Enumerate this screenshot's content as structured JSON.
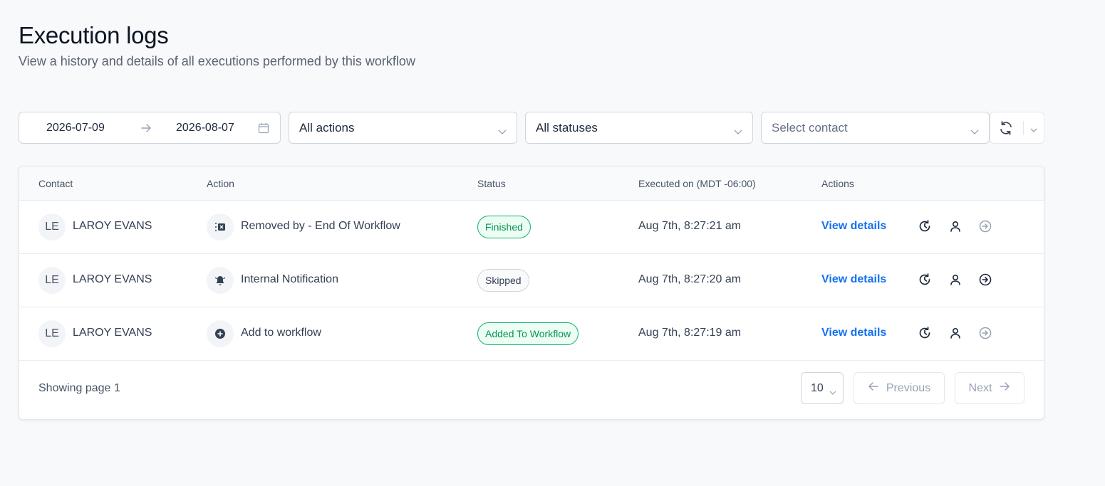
{
  "header": {
    "title": "Execution logs",
    "subtitle": "View a history and details of all executions performed by this workflow"
  },
  "filters": {
    "date_start": "2026-07-09",
    "date_end": "2026-08-07",
    "actions": "All actions",
    "statuses": "All statuses",
    "contact_placeholder": "Select contact"
  },
  "table": {
    "columns": {
      "contact": "Contact",
      "action": "Action",
      "status": "Status",
      "executed_on": "Executed on (MDT -06:00)",
      "actions": "Actions"
    },
    "rows": [
      {
        "initials": "LE",
        "contact": "LAROY EVANS",
        "action": "Removed by - End Of Workflow",
        "action_icon": "remove-from-workflow-icon",
        "status": "Finished",
        "status_style": "green",
        "executed": "Aug 7th, 8:27:21 am",
        "link": "View details",
        "exit_enabled": false
      },
      {
        "initials": "LE",
        "contact": "LAROY EVANS",
        "action": "Internal Notification",
        "action_icon": "bell-icon",
        "status": "Skipped",
        "status_style": "gray",
        "executed": "Aug 7th, 8:27:20 am",
        "link": "View details",
        "exit_enabled": true
      },
      {
        "initials": "LE",
        "contact": "LAROY EVANS",
        "action": "Add to workflow",
        "action_icon": "plus-circle-icon",
        "status": "Added To Workflow",
        "status_style": "green",
        "executed": "Aug 7th, 8:27:19 am",
        "link": "View details",
        "exit_enabled": false
      }
    ]
  },
  "footer": {
    "showing": "Showing page 1",
    "page_size": "10",
    "previous": "Previous",
    "next": "Next"
  },
  "colors": {
    "link": "#1570ef",
    "success": "#17b26a",
    "background": "#f8f9fb"
  }
}
